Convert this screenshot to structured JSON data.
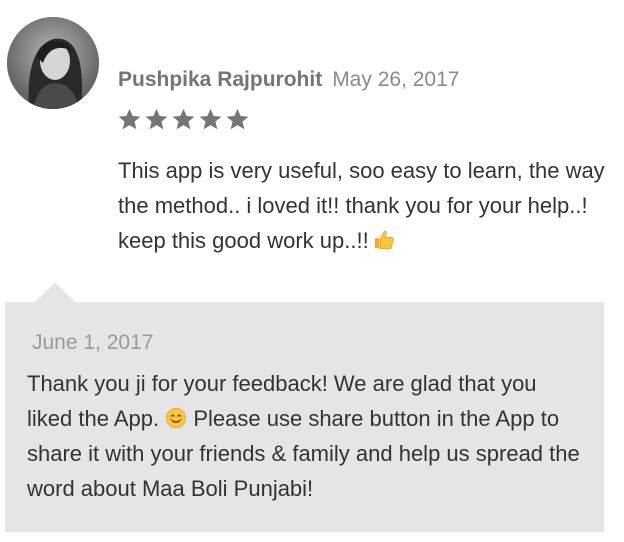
{
  "review": {
    "author": "Pushpika Rajpurohit",
    "date": "May 26, 2017",
    "rating": 5,
    "rating_max": 5,
    "text": "This app is very useful, soo easy to learn, the way the method.. i loved it!! thank you for your help..! keep this good work up..!!",
    "text_emoji_icon": "thumbs-up-icon"
  },
  "reply": {
    "date": "June 1, 2017",
    "text_before_emoji": "Thank you ji for your feedback! We are glad that you liked the App.",
    "emoji_icon": "smiling-face-icon",
    "text_after_emoji": "Please use share button in the App to share it with your friends & family and help us spread the word about Maa Boli Punjabi!"
  },
  "colors": {
    "star": "#757575",
    "reply_background": "#e5e5e5",
    "body_text": "#333333",
    "author": "#757575",
    "date": "#8a8a8a"
  }
}
